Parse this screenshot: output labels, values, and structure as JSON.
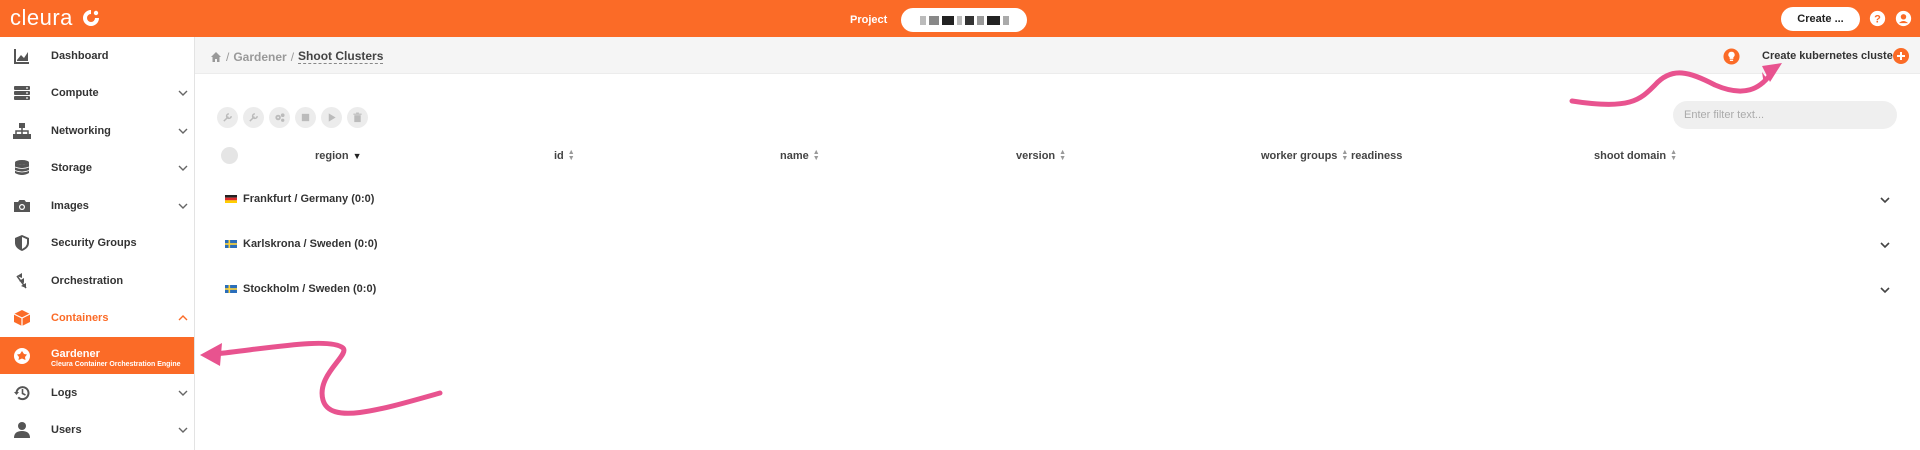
{
  "app": {
    "logo_text": "cleura",
    "brand_color": "#fb6b27"
  },
  "topbar": {
    "project_label": "Project",
    "create_label": "Create ..."
  },
  "sidebar": {
    "items": [
      {
        "label": "Dashboard",
        "icon": "chart-icon"
      },
      {
        "label": "Compute",
        "icon": "server-icon"
      },
      {
        "label": "Networking",
        "icon": "network-icon"
      },
      {
        "label": "Storage",
        "icon": "database-icon"
      },
      {
        "label": "Images",
        "icon": "camera-icon"
      },
      {
        "label": "Security Groups",
        "icon": "shield-icon"
      },
      {
        "label": "Orchestration",
        "icon": "orchestration-icon"
      },
      {
        "label": "Containers",
        "icon": "box-icon"
      },
      {
        "label": "Gardener",
        "sublabel": "Cleura Container Orchestration Engine",
        "icon": "gardener-icon"
      },
      {
        "label": "Logs",
        "icon": "history-icon"
      },
      {
        "label": "Users",
        "icon": "user-icon"
      }
    ]
  },
  "breadcrumb": {
    "parent": "Gardener",
    "current": "Shoot Clusters"
  },
  "header": {
    "create_cluster_label": "Create kubernetes cluster"
  },
  "filter": {
    "placeholder": "Enter filter text..."
  },
  "table": {
    "columns": [
      "region",
      "id",
      "name",
      "version",
      "worker groups",
      "readiness",
      "shoot domain"
    ],
    "groups": [
      {
        "label": "Frankfurt / Germany  (0:0)",
        "flag": "germany"
      },
      {
        "label": "Karlskrona / Sweden  (0:0)",
        "flag": "sweden"
      },
      {
        "label": "Stockholm / Sweden  (0:0)",
        "flag": "sweden"
      }
    ]
  },
  "annotation_color": "#e8538f"
}
